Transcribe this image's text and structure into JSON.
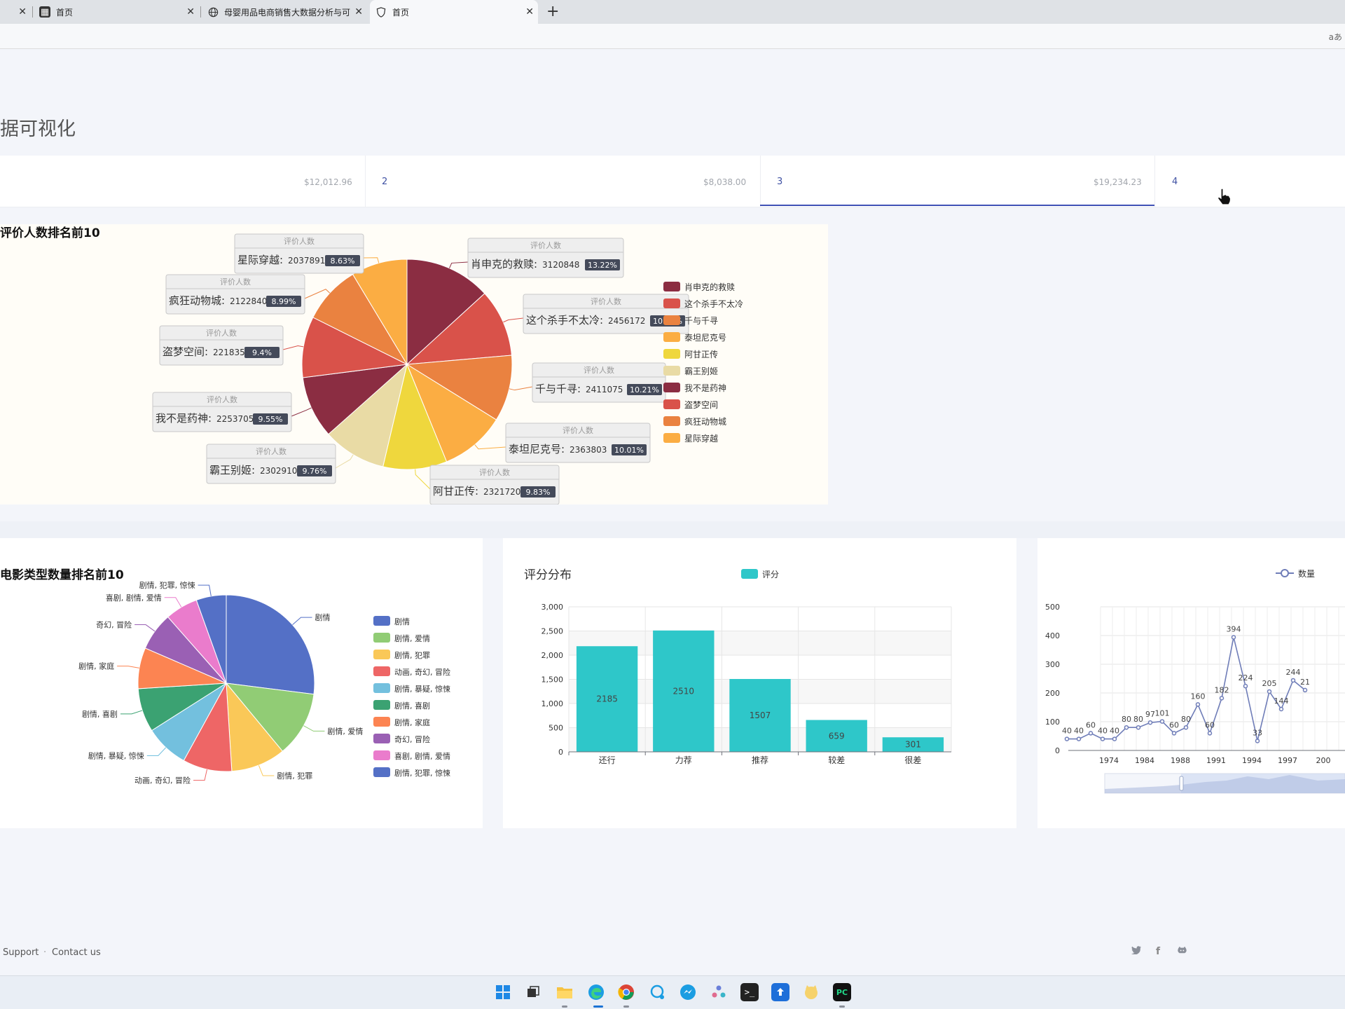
{
  "browser": {
    "tabs": [
      {
        "title": "首页",
        "icon": "film-icon"
      },
      {
        "title": "母婴用品电商销售大数据分析与可",
        "icon": "globe-icon"
      },
      {
        "title": "首页",
        "icon": "shield-icon",
        "active": true
      }
    ],
    "read_aloud_label": "aあ"
  },
  "page": {
    "title_fragment": "据可视化"
  },
  "stats": [
    {
      "value": "$12,012.96",
      "index": "2"
    },
    {
      "value": "$8,038.00",
      "index": "3"
    },
    {
      "value": "$19,234.23",
      "index": "4",
      "active": true
    }
  ],
  "chart_data": [
    {
      "type": "pie",
      "title": "评价人数排名前10",
      "tooltip_header": "评价人数",
      "slices": [
        {
          "name": "肖申克的救赎",
          "value": 3120848,
          "pct": "13.22%",
          "color": "#8b2d42"
        },
        {
          "name": "这个杀手不太冷",
          "value": 2456172,
          "pct": "10.41%",
          "color": "#d9524a"
        },
        {
          "name": "千与千寻",
          "value": 2411075,
          "pct": "10.21%",
          "color": "#ea8240"
        },
        {
          "name": "泰坦尼克号",
          "value": 2363803,
          "pct": "10.01%",
          "color": "#fbad43"
        },
        {
          "name": "阿甘正传",
          "value": 2321720,
          "pct": "9.83%",
          "color": "#efd73d"
        },
        {
          "name": "霸王别姬",
          "value": 2302910,
          "pct": "9.76%",
          "color": "#e9dba5"
        },
        {
          "name": "我不是药神",
          "value": 2253705,
          "pct": "9.55%",
          "color": "#8b2d42"
        },
        {
          "name": "盗梦空间",
          "value": 2218357,
          "pct": "9.4%",
          "color": "#d9524a"
        },
        {
          "name": "疯狂动物城",
          "value": 2122840,
          "pct": "8.99%",
          "color": "#ea8240"
        },
        {
          "name": "星际穿越",
          "value": 2037891,
          "pct": "8.63%",
          "color": "#fbad43"
        }
      ]
    },
    {
      "type": "pie",
      "title": "电影类型数量排名前10",
      "slices": [
        {
          "name": "剧情",
          "value": 27,
          "color": "#5470c6"
        },
        {
          "name": "剧情, 爱情",
          "value": 12,
          "color": "#91cc75"
        },
        {
          "name": "剧情, 犯罪",
          "value": 10,
          "color": "#fac858"
        },
        {
          "name": "动画, 奇幻, 冒险",
          "value": 9,
          "color": "#ee6666"
        },
        {
          "name": "剧情, 暴疑, 惊悚",
          "value": 8,
          "color": "#73c0de"
        },
        {
          "name": "剧情, 喜剧",
          "value": 8,
          "color": "#3ba272"
        },
        {
          "name": "剧情, 家庭",
          "value": 7.5,
          "color": "#fc8452"
        },
        {
          "name": "奇幻, 冒险",
          "value": 7,
          "color": "#9a60b4"
        },
        {
          "name": "喜剧, 剧情, 爱情",
          "value": 6,
          "color": "#ea7ccc"
        },
        {
          "name": "剧情, 犯罪, 惊悚",
          "value": 5.5,
          "color": "#5470c6"
        }
      ]
    },
    {
      "type": "bar",
      "title": "评分分布",
      "legend": "评分",
      "color": "#2ec7c9",
      "categories": [
        "还行",
        "力荐",
        "推荐",
        "较差",
        "很差"
      ],
      "values": [
        2185,
        2510,
        1507,
        659,
        301
      ],
      "ylim": [
        0,
        3000
      ],
      "yticks": [
        "0",
        "500",
        "1,000",
        "1,500",
        "2,000",
        "2,500",
        "3,000"
      ]
    },
    {
      "type": "line",
      "legend": "数量",
      "color": "#6f7db8",
      "ylim": [
        0,
        500
      ],
      "yticks": [
        "0",
        "100",
        "200",
        "300",
        "400",
        "500"
      ],
      "xticks": [
        "1974",
        "1984",
        "1988",
        "1991",
        "1994",
        "1997",
        "200"
      ],
      "values": [
        40,
        40,
        60,
        40,
        40,
        80,
        80,
        97,
        101,
        60,
        80,
        160,
        60,
        182,
        394,
        224,
        33,
        205,
        144,
        244,
        210
      ],
      "labels": [
        "40",
        "40",
        "60",
        "40",
        "40",
        "80",
        "80",
        "97",
        "101",
        "60",
        "80",
        "160",
        "60",
        "182",
        "394",
        "224",
        "33",
        "205",
        "144",
        "244",
        "21"
      ]
    }
  ],
  "footer": {
    "support": "Support",
    "contact": "Contact us"
  }
}
